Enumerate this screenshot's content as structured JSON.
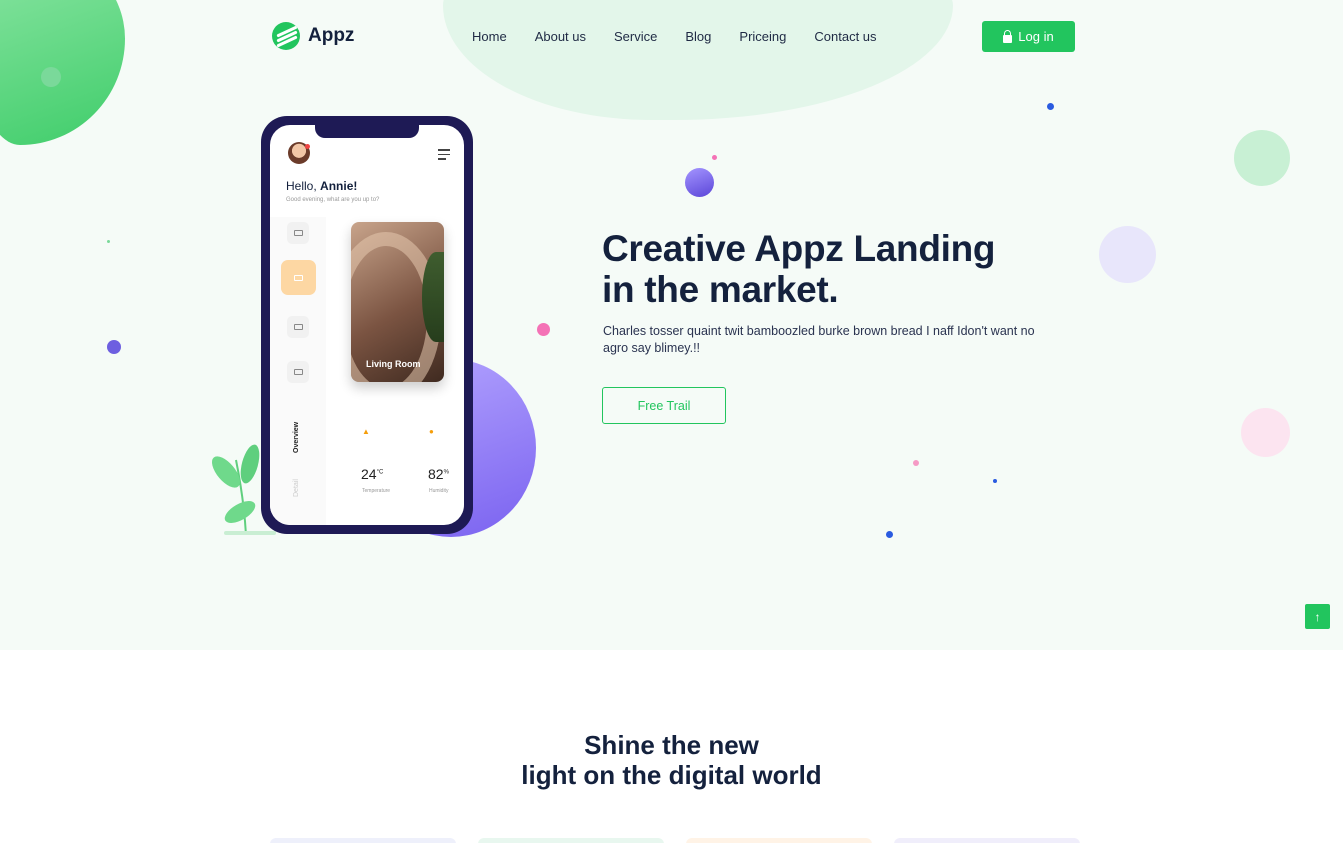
{
  "brand": {
    "name": "Appz",
    "accent": "#22c55e",
    "dark": "#14213d"
  },
  "nav": {
    "items": [
      {
        "label": "Home"
      },
      {
        "label": "About us"
      },
      {
        "label": "Service"
      },
      {
        "label": "Blog"
      },
      {
        "label": "Priceing"
      },
      {
        "label": "Contact us"
      }
    ],
    "login_label": "Log in",
    "login_icon": "lock-icon"
  },
  "phone": {
    "greeting_prefix": "Hello,",
    "greeting_name": "Annie!",
    "greeting_sub": "Good evening, what are you up to?",
    "card_label": "Living Room",
    "tab_overview": "Overview",
    "tab_detail": "Detail",
    "temperature_value": "24",
    "temperature_unit": "°C",
    "temperature_label": "Temperature",
    "humidity_value": "82",
    "humidity_unit": "%",
    "humidity_label": "Humidity"
  },
  "hero": {
    "title_line1": "Creative Appz Landing",
    "title_line2": "in the market.",
    "description": "Charles tosser quaint twit bamboozled burke brown bread I naff Idon't want no agro say blimey.!!",
    "cta_label": "Free Trail"
  },
  "scroll_top_icon": "arrow-up-icon",
  "section": {
    "title_line1": "Shine the new",
    "title_line2": "light on the digital world"
  },
  "colors": {
    "hero_bg": "#f5fbf7",
    "purple": "#7a62f0",
    "pink": "#f472b6"
  }
}
